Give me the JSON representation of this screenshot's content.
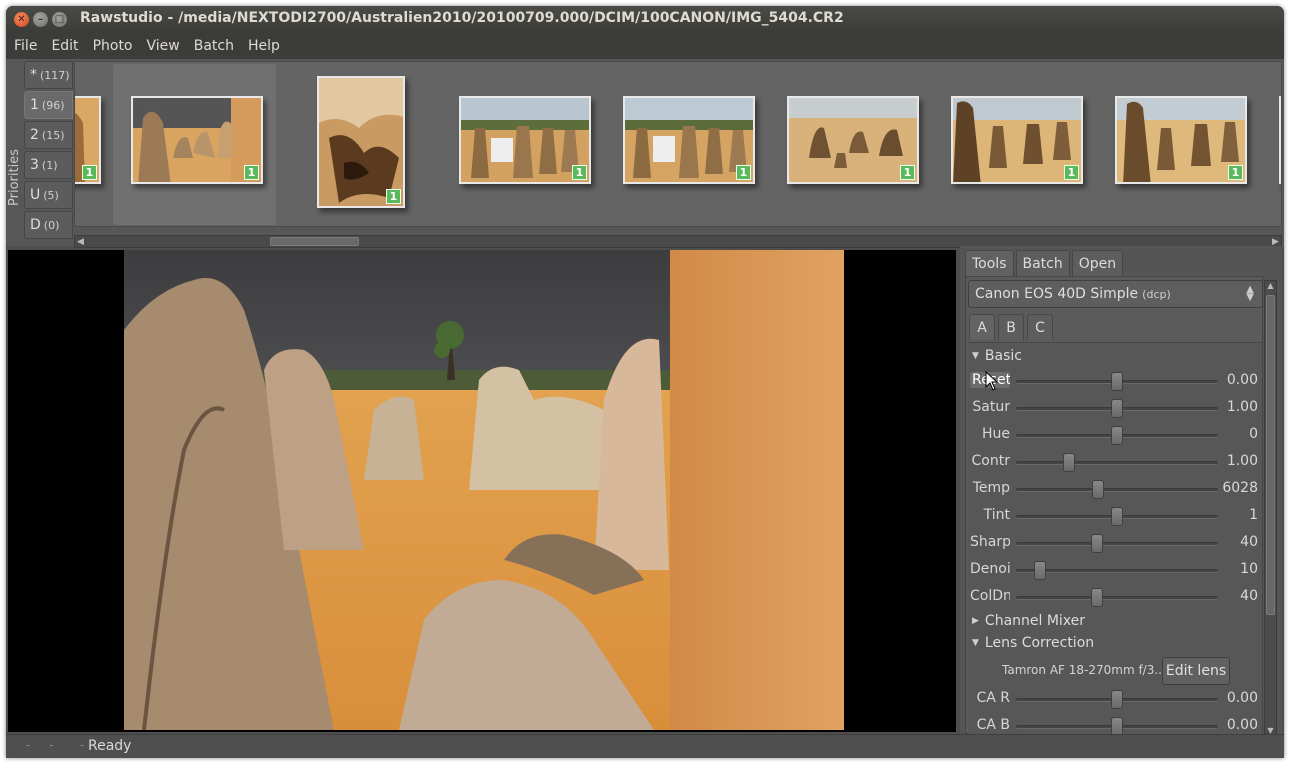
{
  "window": {
    "title": "Rawstudio - /media/NEXTODI2700/Australien2010/20100709.000/DCIM/100CANON/IMG_5404.CR2"
  },
  "menu": [
    "File",
    "Edit",
    "Photo",
    "View",
    "Batch",
    "Help"
  ],
  "priorities": {
    "label": "Priorities",
    "tabs": [
      {
        "name": "*",
        "count": "(117)"
      },
      {
        "name": "1",
        "count": "(96)"
      },
      {
        "name": "2",
        "count": "(15)"
      },
      {
        "name": "3",
        "count": "(1)"
      },
      {
        "name": "U",
        "count": "(5)"
      },
      {
        "name": "D",
        "count": "(0)"
      }
    ]
  },
  "thumbnails": {
    "priority_flag": "1"
  },
  "tools_panel": {
    "tabs": [
      "Tools",
      "Batch",
      "Open"
    ],
    "profile": {
      "name": "Canon EOS 40D Simple",
      "suffix": "(dcp)"
    },
    "snapshot_tabs": [
      "A",
      "B",
      "C"
    ],
    "basic": {
      "title": "Basic",
      "rows": [
        {
          "label": "Reset",
          "value": "0.00"
        },
        {
          "label": "Satur",
          "value": "1.00"
        },
        {
          "label": "Hue",
          "value": "0"
        },
        {
          "label": "Contr",
          "value": "1.00"
        },
        {
          "label": "Temp",
          "value": "6028"
        },
        {
          "label": "Tint",
          "value": "1"
        },
        {
          "label": "Sharp",
          "value": "40"
        },
        {
          "label": "Denoi",
          "value": "10"
        },
        {
          "label": "ColDn",
          "value": "40"
        }
      ]
    },
    "channel_mixer": {
      "title": "Channel Mixer"
    },
    "lens_correction": {
      "title": "Lens Correction",
      "lens": "Tamron AF 18-270mm f/3...",
      "edit_button": "Edit lens",
      "rows": [
        {
          "label": "CA R",
          "value": "0.00"
        },
        {
          "label": "CA B",
          "value": "0.00"
        }
      ]
    }
  },
  "status": {
    "text": "Ready"
  }
}
